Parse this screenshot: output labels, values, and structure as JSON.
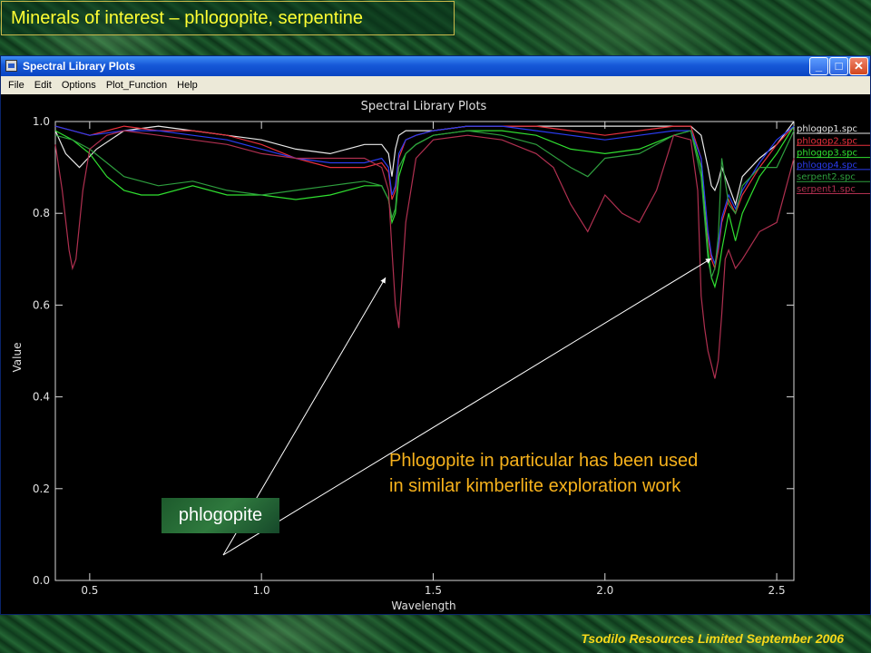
{
  "slide": {
    "title": "Minerals of interest – phlogopite, serpentine",
    "footer": "Tsodilo Resources Limited September 2006",
    "callout": "phlogopite",
    "note_line1": "Phlogopite in particular has been used",
    "note_line2": "in similar kimberlite exploration work"
  },
  "window": {
    "title": "Spectral Library Plots",
    "buttons": {
      "minimize": "_",
      "maximize": "□",
      "close": "✕"
    },
    "icon": "app-window-icon"
  },
  "menu": [
    "File",
    "Edit",
    "Options",
    "Plot_Function",
    "Help"
  ],
  "colors": {
    "phlogop1": "#e8e8e8",
    "phlogop2": "#e8303c",
    "phlogop3": "#30e030",
    "phlogop4": "#2a3cf0",
    "serpent2": "#2e9e3e",
    "serpent1": "#b03050",
    "accent_title": "#ffff33",
    "accent_note": "#f7b21c"
  },
  "chart_data": {
    "type": "line",
    "title": "Spectral Library Plots",
    "xlabel": "Wavelength",
    "ylabel": "Value",
    "xlim": [
      0.4,
      2.55
    ],
    "ylim": [
      0.0,
      1.0
    ],
    "xticks": [
      0.5,
      1.0,
      1.5,
      2.0,
      2.5
    ],
    "xtick_labels": [
      "0.5",
      "1.0",
      "1.5",
      "2.0",
      "2.5"
    ],
    "yticks": [
      0.0,
      0.2,
      0.4,
      0.6,
      0.8,
      1.0
    ],
    "ytick_labels": [
      "0.0",
      "0.2",
      "0.4",
      "0.6",
      "0.8",
      "1.0"
    ],
    "grid": false,
    "legend_position": "right",
    "series": [
      {
        "name": "phlogop1.spc",
        "color": "#e8e8e8",
        "x": [
          0.4,
          0.43,
          0.47,
          0.52,
          0.6,
          0.7,
          0.8,
          0.9,
          1.0,
          1.1,
          1.2,
          1.3,
          1.35,
          1.37,
          1.38,
          1.39,
          1.4,
          1.42,
          1.45,
          1.5,
          1.6,
          1.7,
          1.8,
          1.9,
          2.0,
          2.1,
          2.2,
          2.25,
          2.28,
          2.3,
          2.31,
          2.32,
          2.33,
          2.34,
          2.36,
          2.38,
          2.4,
          2.45,
          2.5,
          2.55
        ],
        "y": [
          0.98,
          0.93,
          0.9,
          0.94,
          0.98,
          0.99,
          0.98,
          0.97,
          0.96,
          0.94,
          0.93,
          0.95,
          0.95,
          0.93,
          0.88,
          0.94,
          0.97,
          0.98,
          0.98,
          0.98,
          0.99,
          0.99,
          0.99,
          0.99,
          0.99,
          0.99,
          0.99,
          0.99,
          0.97,
          0.9,
          0.86,
          0.85,
          0.87,
          0.9,
          0.86,
          0.82,
          0.88,
          0.92,
          0.95,
          1.0
        ]
      },
      {
        "name": "phlogop2.spc",
        "color": "#e8303c",
        "x": [
          0.4,
          0.45,
          0.5,
          0.6,
          0.7,
          0.8,
          0.9,
          1.0,
          1.1,
          1.2,
          1.3,
          1.35,
          1.37,
          1.38,
          1.39,
          1.4,
          1.42,
          1.45,
          1.5,
          1.6,
          1.7,
          1.8,
          1.9,
          2.0,
          2.1,
          2.2,
          2.25,
          2.28,
          2.3,
          2.31,
          2.32,
          2.33,
          2.34,
          2.36,
          2.38,
          2.4,
          2.45,
          2.5,
          2.55
        ],
        "y": [
          0.99,
          0.98,
          0.97,
          0.99,
          0.98,
          0.98,
          0.97,
          0.95,
          0.92,
          0.9,
          0.9,
          0.91,
          0.89,
          0.83,
          0.85,
          0.92,
          0.96,
          0.97,
          0.98,
          0.99,
          0.99,
          0.99,
          0.98,
          0.97,
          0.98,
          0.99,
          0.99,
          0.92,
          0.75,
          0.7,
          0.68,
          0.72,
          0.78,
          0.83,
          0.8,
          0.84,
          0.9,
          0.95,
          0.99
        ]
      },
      {
        "name": "phlogop3.spc",
        "color": "#30e030",
        "x": [
          0.4,
          0.45,
          0.5,
          0.55,
          0.6,
          0.65,
          0.7,
          0.8,
          0.9,
          1.0,
          1.1,
          1.2,
          1.3,
          1.35,
          1.37,
          1.38,
          1.39,
          1.4,
          1.42,
          1.45,
          1.5,
          1.6,
          1.7,
          1.8,
          1.9,
          2.0,
          2.1,
          2.2,
          2.25,
          2.28,
          2.3,
          2.31,
          2.32,
          2.33,
          2.34,
          2.36,
          2.38,
          2.4,
          2.45,
          2.5,
          2.55
        ],
        "y": [
          0.98,
          0.96,
          0.93,
          0.88,
          0.85,
          0.84,
          0.84,
          0.86,
          0.84,
          0.84,
          0.83,
          0.84,
          0.86,
          0.86,
          0.83,
          0.78,
          0.8,
          0.88,
          0.93,
          0.95,
          0.97,
          0.98,
          0.98,
          0.97,
          0.94,
          0.93,
          0.94,
          0.97,
          0.98,
          0.9,
          0.72,
          0.66,
          0.64,
          0.67,
          0.72,
          0.8,
          0.74,
          0.8,
          0.88,
          0.93,
          0.99
        ]
      },
      {
        "name": "phlogop4.spc",
        "color": "#2a3cf0",
        "x": [
          0.4,
          0.45,
          0.5,
          0.6,
          0.7,
          0.8,
          0.9,
          1.0,
          1.1,
          1.2,
          1.3,
          1.35,
          1.37,
          1.38,
          1.39,
          1.4,
          1.42,
          1.45,
          1.5,
          1.6,
          1.7,
          1.8,
          1.9,
          2.0,
          2.1,
          2.2,
          2.25,
          2.28,
          2.3,
          2.31,
          2.32,
          2.33,
          2.34,
          2.36,
          2.38,
          2.4,
          2.45,
          2.5,
          2.55
        ],
        "y": [
          0.99,
          0.98,
          0.97,
          0.98,
          0.98,
          0.97,
          0.96,
          0.94,
          0.92,
          0.91,
          0.91,
          0.92,
          0.9,
          0.84,
          0.86,
          0.93,
          0.96,
          0.97,
          0.98,
          0.99,
          0.99,
          0.98,
          0.97,
          0.96,
          0.97,
          0.98,
          0.98,
          0.92,
          0.76,
          0.71,
          0.69,
          0.73,
          0.79,
          0.84,
          0.81,
          0.85,
          0.91,
          0.96,
          0.99
        ]
      },
      {
        "name": "serpent2.spc",
        "color": "#2e9e3e",
        "x": [
          0.4,
          0.45,
          0.5,
          0.55,
          0.6,
          0.7,
          0.8,
          0.9,
          1.0,
          1.1,
          1.2,
          1.3,
          1.35,
          1.37,
          1.38,
          1.39,
          1.4,
          1.42,
          1.45,
          1.5,
          1.6,
          1.7,
          1.8,
          1.9,
          1.95,
          2.0,
          2.1,
          2.2,
          2.25,
          2.28,
          2.3,
          2.31,
          2.32,
          2.33,
          2.34,
          2.36,
          2.38,
          2.4,
          2.45,
          2.5,
          2.55
        ],
        "y": [
          0.97,
          0.96,
          0.94,
          0.91,
          0.88,
          0.86,
          0.87,
          0.85,
          0.84,
          0.85,
          0.86,
          0.87,
          0.86,
          0.83,
          0.79,
          0.81,
          0.9,
          0.93,
          0.95,
          0.97,
          0.98,
          0.97,
          0.95,
          0.9,
          0.88,
          0.92,
          0.93,
          0.97,
          0.98,
          0.88,
          0.7,
          0.66,
          0.68,
          0.75,
          0.92,
          0.82,
          0.8,
          0.86,
          0.9,
          0.9,
          0.98
        ]
      },
      {
        "name": "serpent1.spc",
        "color": "#b03050",
        "x": [
          0.4,
          0.42,
          0.44,
          0.45,
          0.46,
          0.48,
          0.5,
          0.55,
          0.6,
          0.7,
          0.8,
          0.9,
          1.0,
          1.1,
          1.2,
          1.3,
          1.35,
          1.37,
          1.38,
          1.39,
          1.4,
          1.42,
          1.45,
          1.5,
          1.6,
          1.7,
          1.8,
          1.85,
          1.9,
          1.95,
          2.0,
          2.05,
          2.1,
          2.15,
          2.2,
          2.25,
          2.27,
          2.28,
          2.29,
          2.3,
          2.31,
          2.32,
          2.33,
          2.34,
          2.35,
          2.36,
          2.38,
          2.4,
          2.45,
          2.5,
          2.55
        ],
        "y": [
          0.95,
          0.85,
          0.72,
          0.68,
          0.7,
          0.85,
          0.94,
          0.97,
          0.98,
          0.97,
          0.96,
          0.95,
          0.93,
          0.92,
          0.92,
          0.92,
          0.9,
          0.85,
          0.72,
          0.6,
          0.55,
          0.78,
          0.92,
          0.96,
          0.97,
          0.96,
          0.93,
          0.9,
          0.82,
          0.76,
          0.84,
          0.8,
          0.78,
          0.85,
          0.97,
          0.96,
          0.85,
          0.62,
          0.55,
          0.5,
          0.47,
          0.44,
          0.48,
          0.58,
          0.7,
          0.72,
          0.68,
          0.7,
          0.76,
          0.78,
          0.92
        ]
      }
    ]
  }
}
